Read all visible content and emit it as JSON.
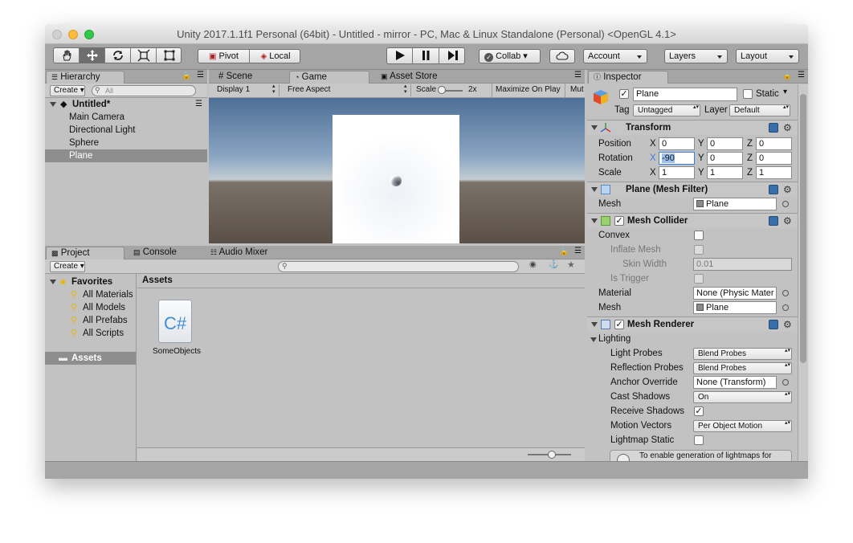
{
  "window": {
    "title": "Unity 2017.1.1f1 Personal (64bit) - Untitled - mirror - PC, Mac & Linux Standalone (Personal) <OpenGL 4.1>"
  },
  "toolbar": {
    "pivot": "Pivot",
    "local": "Local",
    "collab": "Collab ▾",
    "account": "Account",
    "layers": "Layers",
    "layout": "Layout"
  },
  "hierarchy": {
    "tab": "Hierarchy",
    "create": "Create ▾",
    "search_placeholder": "All",
    "scene": "Untitled*",
    "items": [
      "Main Camera",
      "Directional Light",
      "Sphere",
      "Plane"
    ]
  },
  "views": {
    "tabs": [
      "Scene",
      "Game",
      "Asset Store"
    ],
    "display": "Display 1",
    "aspect": "Free Aspect",
    "scale_label": "Scale",
    "scale_value": "2x",
    "maximize": "Maximize On Play",
    "mute": "Mut"
  },
  "project": {
    "tabs": [
      "Project",
      "Console",
      "Audio Mixer"
    ],
    "create": "Create ▾",
    "favorites": "Favorites",
    "favorite_items": [
      "All Materials",
      "All Models",
      "All Prefabs",
      "All Scripts"
    ],
    "assets_folder": "Assets",
    "breadcrumb": "Assets",
    "file_name": "SomeObjects",
    "file_icon_text": "C#"
  },
  "inspector": {
    "tab": "Inspector",
    "object_name": "Plane",
    "static_label": "Static",
    "tag_label": "Tag",
    "tag_value": "Untagged",
    "layer_label": "Layer",
    "layer_value": "Default",
    "transform": {
      "title": "Transform",
      "rows": [
        {
          "label": "Position",
          "x": "0",
          "y": "0",
          "z": "0"
        },
        {
          "label": "Rotation",
          "x": "-90",
          "y": "0",
          "z": "0"
        },
        {
          "label": "Scale",
          "x": "1",
          "y": "1",
          "z": "1"
        }
      ],
      "axes": [
        "X",
        "Y",
        "Z"
      ]
    },
    "mesh_filter": {
      "title": "Plane (Mesh Filter)",
      "mesh_label": "Mesh",
      "mesh_value": "Plane"
    },
    "mesh_collider": {
      "title": "Mesh Collider",
      "convex": "Convex",
      "inflate_mesh": "Inflate Mesh",
      "skin_width": "Skin Width",
      "skin_width_value": "0.01",
      "is_trigger": "Is Trigger",
      "material_label": "Material",
      "material_value": "None (Physic Mater",
      "mesh_label": "Mesh",
      "mesh_value": "Plane"
    },
    "mesh_renderer": {
      "title": "Mesh Renderer",
      "lighting": "Lighting",
      "light_probes": "Light Probes",
      "light_probes_value": "Blend Probes",
      "reflection_probes": "Reflection Probes",
      "reflection_probes_value": "Blend Probes",
      "anchor_override": "Anchor Override",
      "anchor_override_value": "None (Transform)",
      "cast_shadows": "Cast Shadows",
      "cast_shadows_value": "On",
      "receive_shadows": "Receive Shadows",
      "motion_vectors": "Motion Vectors",
      "motion_vectors_value": "Per Object Motion",
      "lightmap_static": "Lightmap Static",
      "info": "To enable generation of lightmaps for"
    }
  },
  "colors": {
    "accent_blue": "#3d7bd9",
    "selection": "#8e8e8e",
    "panel": "#c2c2c2"
  }
}
